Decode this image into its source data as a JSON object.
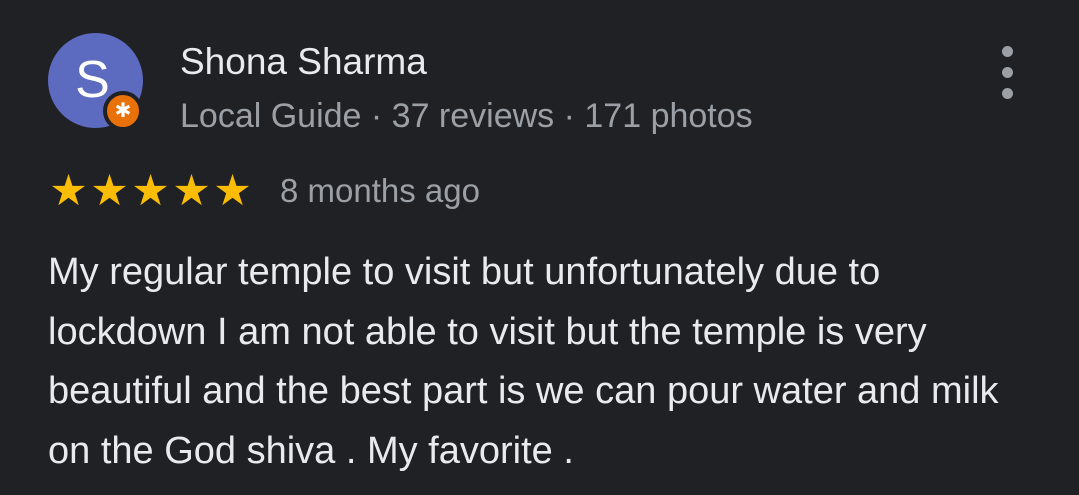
{
  "reviewer": {
    "avatar_initial": "S",
    "avatar_color": "#5c6bc0",
    "badge_icon": "star-icon",
    "badge_color": "#e8710a",
    "badge_glyph": "✱",
    "name": "Shona Sharma",
    "meta": "Local Guide · 37 reviews · 171 photos"
  },
  "review": {
    "rating": 5,
    "rating_max": 5,
    "star_color": "#fbbc04",
    "date": "8 months ago",
    "text": "My regular temple to visit but unfortunately due to lockdown I am not able to visit but the temple is very beautiful and the best part is we can pour water and milk on the God shiva . My favorite ."
  },
  "actions": {
    "more_icon": "more-vert-icon"
  }
}
